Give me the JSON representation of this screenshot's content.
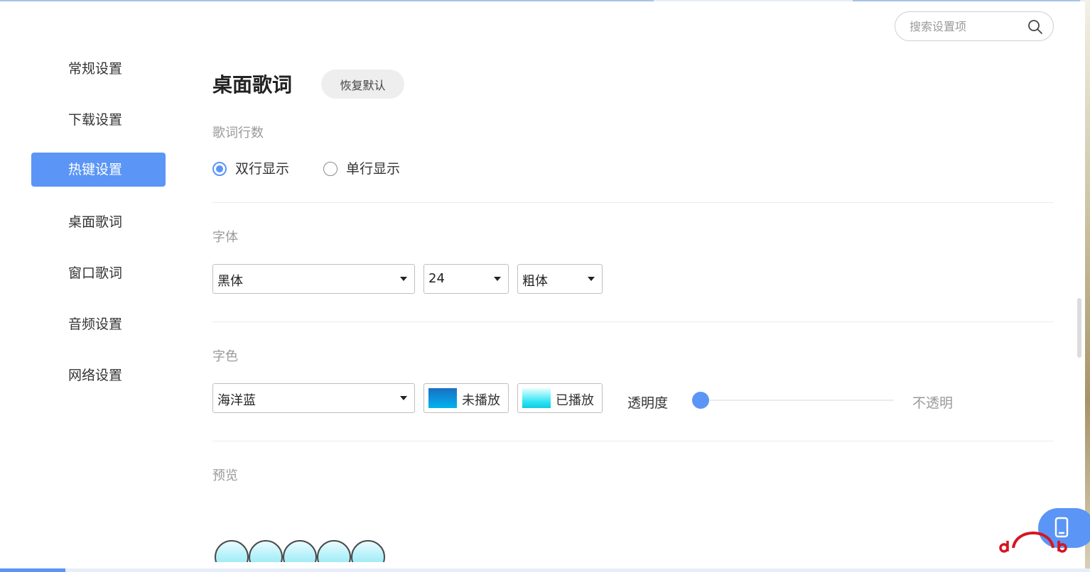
{
  "colors": {
    "accent": "#5b95f6",
    "muted_text": "#999999",
    "unplayed_swatch": "#0096dc",
    "played_swatch": "#2be3f3"
  },
  "search": {
    "placeholder": "搜索设置项",
    "icon": "search-icon"
  },
  "sidebar": {
    "active_index": 2,
    "items": [
      {
        "label": "常规设置"
      },
      {
        "label": "下载设置"
      },
      {
        "label": "热键设置"
      },
      {
        "label": "桌面歌词"
      },
      {
        "label": "窗口歌词"
      },
      {
        "label": "音频设置"
      },
      {
        "label": "网络设置"
      }
    ]
  },
  "main": {
    "title": "桌面歌词",
    "reset_label": "恢复默认",
    "lines": {
      "label": "歌词行数",
      "options": [
        "双行显示",
        "单行显示"
      ],
      "selected": "双行显示"
    },
    "font": {
      "label": "字体",
      "family": "黑体",
      "size": "24",
      "weight": "粗体"
    },
    "color": {
      "label": "字色",
      "scheme": "海洋蓝",
      "unplayed_label": "未播放",
      "played_label": "已播放",
      "opacity_label": "透明度",
      "opacity_end_label": "不透明",
      "opacity_value": 0
    },
    "preview": {
      "label": "预览"
    }
  },
  "floating": {
    "icon": "phone-icon"
  }
}
